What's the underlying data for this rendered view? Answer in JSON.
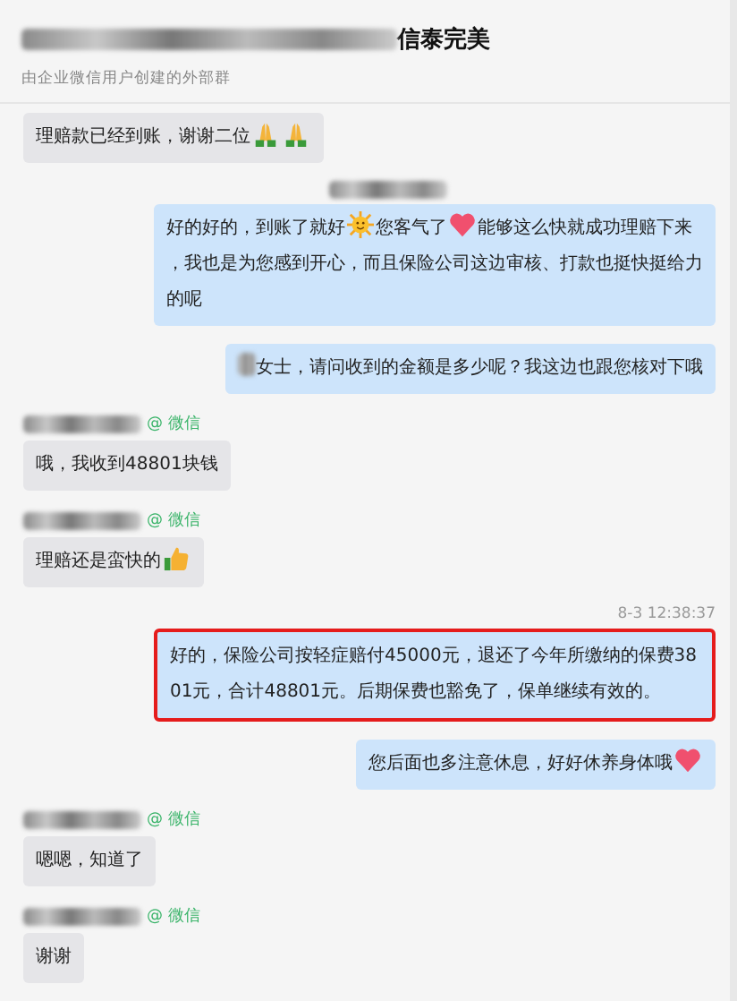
{
  "header": {
    "title_suffix": "信泰完美",
    "subtitle": "由企业微信用户创建的外部群"
  },
  "messages": [
    {
      "outgoing": false,
      "highlighted": false,
      "parts": [
        {
          "kind": "text",
          "text": "理赔款已经到账，谢谢二位"
        },
        {
          "kind": "pray"
        },
        {
          "kind": "pray"
        }
      ]
    },
    {
      "outgoing": true,
      "sender": {
        "redacted": true
      },
      "highlighted": false,
      "parts": [
        {
          "kind": "text",
          "text": "好的好的，到账了就好"
        },
        {
          "kind": "sun"
        },
        {
          "kind": "text",
          "text": "您客气了"
        },
        {
          "kind": "heart"
        },
        {
          "kind": "text",
          "text": "能够这么快就成功理赔下来"
        },
        {
          "kind": "paragraph",
          "text": "，我也是为您感到开心，而且保险公司这边审核、打款也挺快挺给力的呢"
        }
      ]
    },
    {
      "outgoing": true,
      "highlighted": false,
      "parts": [
        {
          "kind": "redacted"
        },
        {
          "kind": "text",
          "text": "女士，请问收到的金额是多少呢？我这边也跟您核对下哦"
        }
      ]
    },
    {
      "outgoing": false,
      "sender": {
        "app": "@ 微信"
      },
      "highlighted": false,
      "parts": [
        {
          "kind": "text",
          "text": "哦，我收到48801块钱"
        }
      ]
    },
    {
      "outgoing": false,
      "sender": {
        "app": "@ 微信"
      },
      "highlighted": false,
      "parts": [
        {
          "kind": "text",
          "text": "理赔还是蛮快的"
        },
        {
          "kind": "thumb"
        }
      ]
    },
    {
      "outgoing": true,
      "time": "8-3 12:38:37",
      "highlighted": true,
      "parts": [
        {
          "kind": "text",
          "text": "好的，保险公司按轻症赔付45000元，退还了今年所缴纳的保费3801元，合计48801元。后期保费也豁免了，保单继续有效的。"
        }
      ]
    },
    {
      "outgoing": true,
      "highlighted": false,
      "parts": [
        {
          "kind": "text",
          "text": "您后面也多注意休息，好好休养身体哦"
        },
        {
          "kind": "heart"
        }
      ]
    },
    {
      "outgoing": false,
      "sender": {
        "app": "@ 微信"
      },
      "highlighted": false,
      "parts": [
        {
          "kind": "text",
          "text": "嗯嗯，知道了"
        }
      ]
    },
    {
      "outgoing": false,
      "sender": {
        "app": "@ 微信"
      },
      "highlighted": false,
      "parts": [
        {
          "kind": "text",
          "text": "谢谢"
        }
      ]
    }
  ]
}
